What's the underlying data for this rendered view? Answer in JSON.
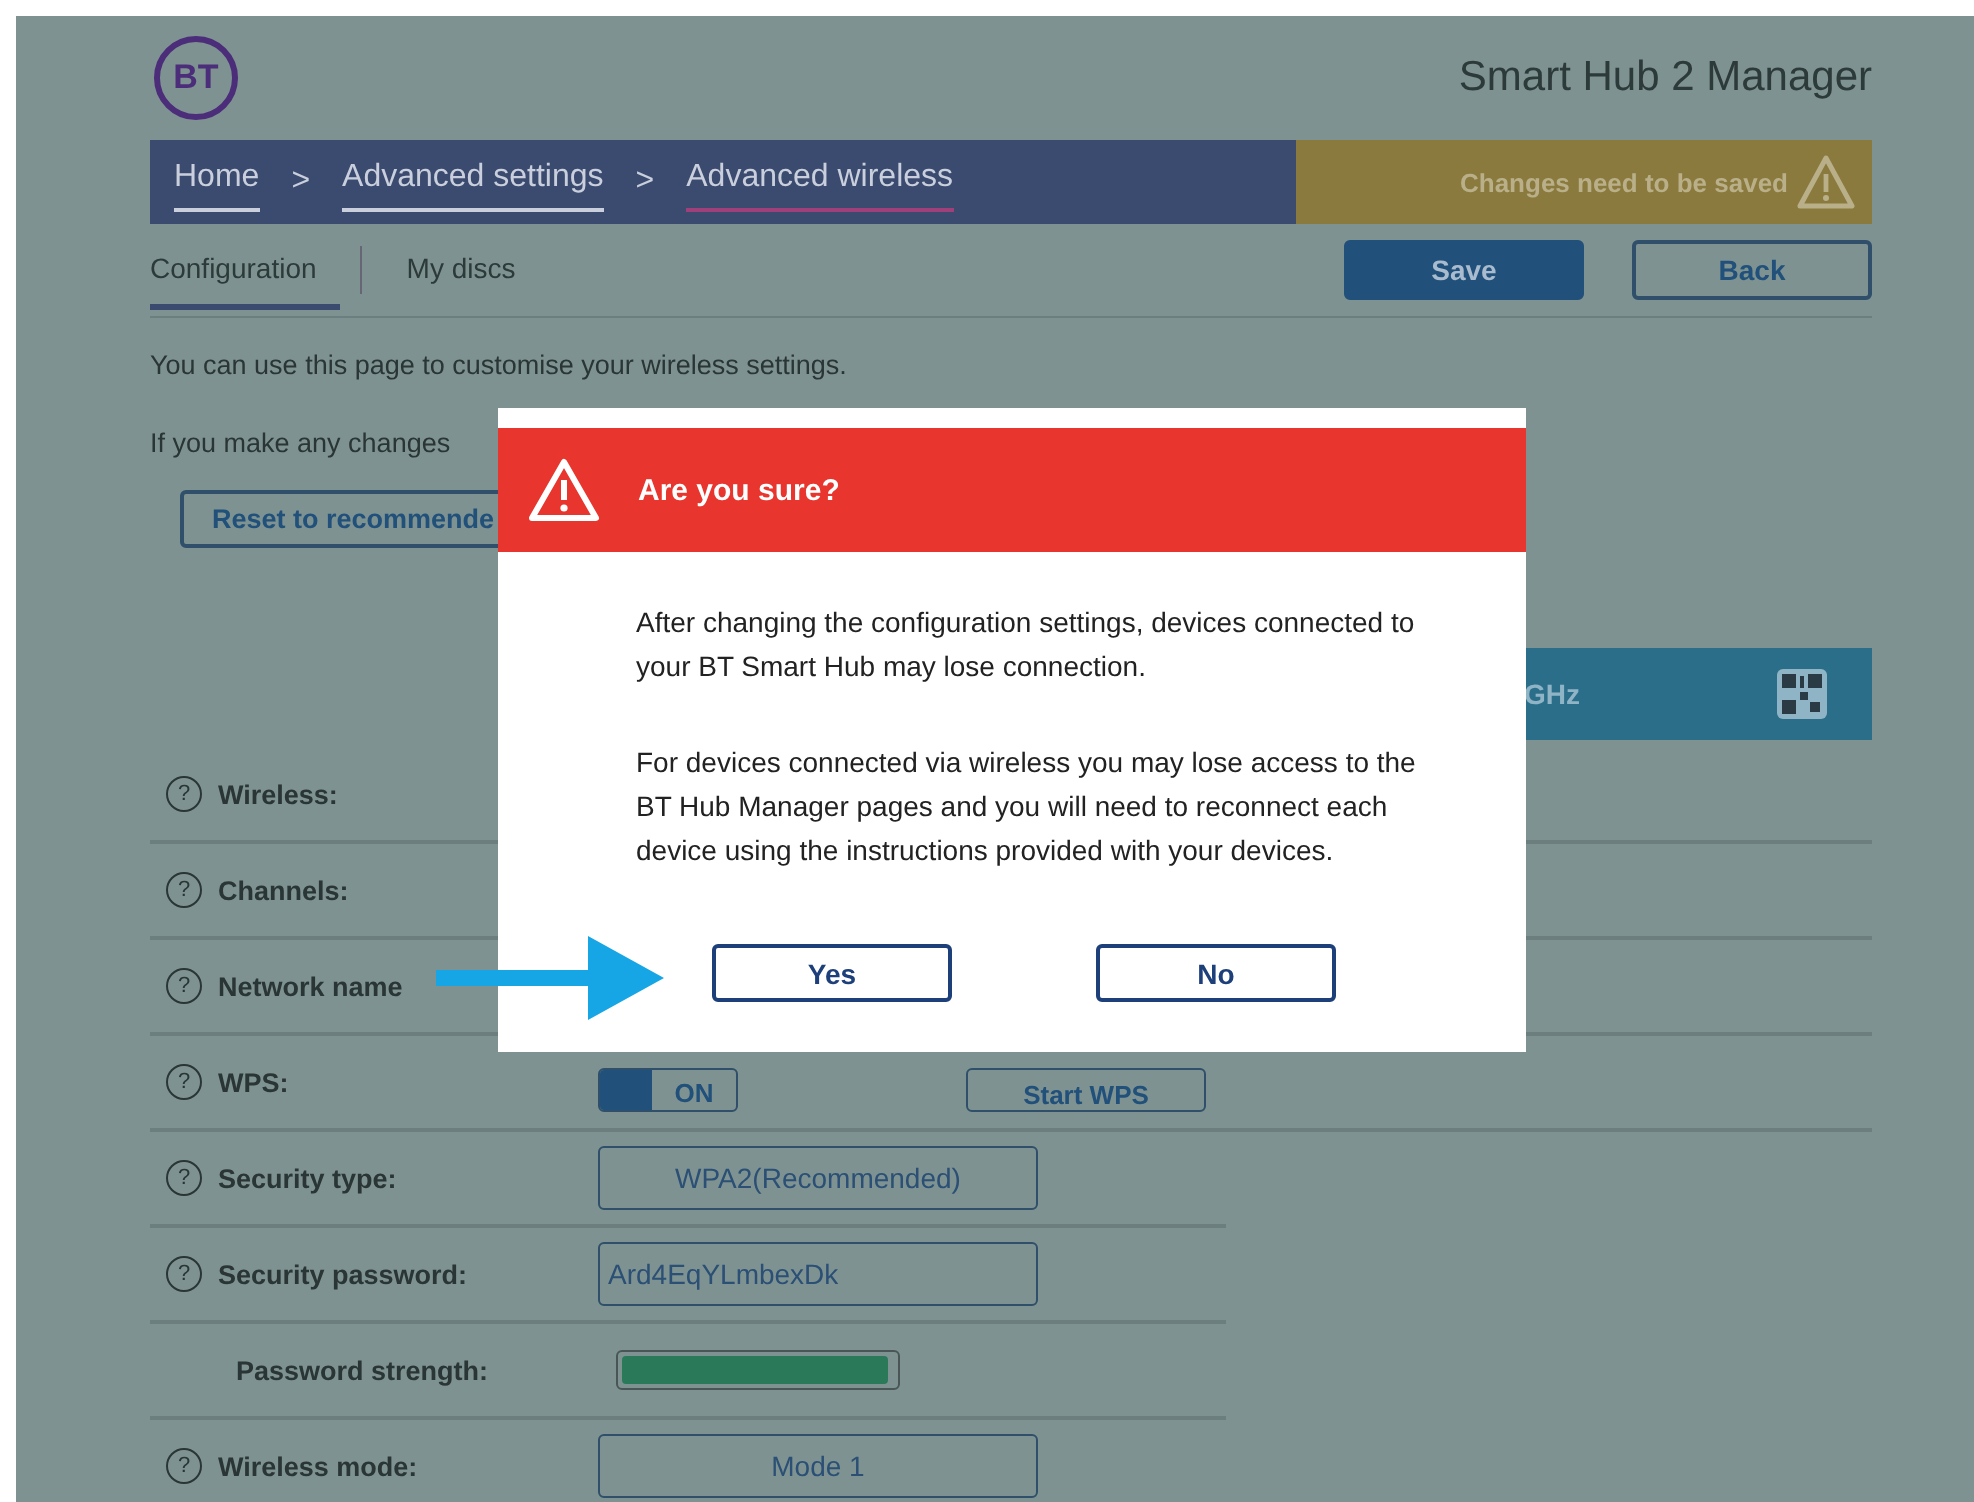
{
  "header": {
    "logo": "BT",
    "title": "Smart Hub 2 Manager"
  },
  "breadcrumb": [
    {
      "label": "Home",
      "selected": false
    },
    {
      "label": "Advanced settings",
      "selected": false
    },
    {
      "label": "Advanced wireless",
      "selected": true
    }
  ],
  "separators": [
    ">",
    ">"
  ],
  "alert": {
    "text": "Changes need to be saved"
  },
  "tabs": [
    {
      "label": "Configuration",
      "selected": true
    },
    {
      "label": "My discs",
      "selected": false
    }
  ],
  "actions": [
    {
      "label": "Save",
      "kind": "primary"
    },
    {
      "label": "Back",
      "kind": "secondary"
    }
  ],
  "intro": "You can use this page to customise your wireless settings.",
  "changes_note": "If you make any changes",
  "reset_button": "Reset to recommende",
  "band": {
    "text": "GHz"
  },
  "rows": [
    {
      "help": "?",
      "label": "Wireless:"
    },
    {
      "help": "?",
      "label": "Channels:"
    },
    {
      "help": "?",
      "label": "Network name"
    },
    {
      "help": "?",
      "label": "WPS:",
      "kind": "toggle",
      "value": "ON",
      "on": true,
      "button": "Start WPS"
    },
    {
      "help": "?",
      "label": "Security type:",
      "kind": "select",
      "value": "WPA2(Recommended)"
    },
    {
      "help": "?",
      "label": "Security password:",
      "kind": "text",
      "value": "Ard4EqYLmbexDk"
    },
    {
      "label": "Password strength:",
      "kind": "meter",
      "level": 0.98
    },
    {
      "help": "?",
      "label": "Wireless mode:",
      "kind": "select",
      "value": "Mode 1"
    }
  ],
  "dialog": {
    "title": "Are you sure?",
    "paragraphs": [
      "After changing the configuration settings, devices connected to your BT Smart Hub may lose connection.",
      "For devices connected via wireless you may lose access to the BT Hub Manager pages and you will need to reconnect each device using the instructions provided with your devices."
    ],
    "buttons": [
      "Yes",
      "No"
    ]
  }
}
